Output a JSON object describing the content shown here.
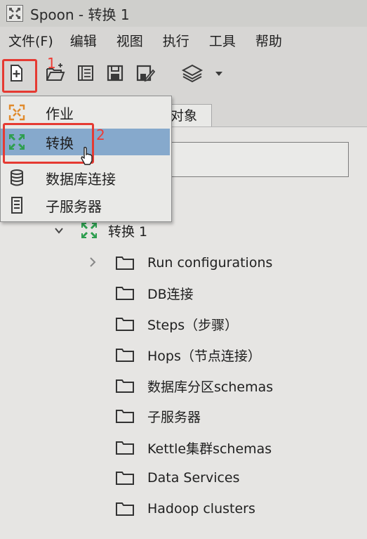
{
  "window": {
    "title": "Spoon - 转换 1"
  },
  "menu": {
    "file": "文件(F)",
    "edit": "编辑",
    "view": "视图",
    "run": "执行",
    "tools": "工具",
    "help": "帮助"
  },
  "toolbar": {
    "icons": [
      "new-file-icon",
      "open-folder-icon",
      "explore-icon",
      "save-icon",
      "save-as-icon",
      "layers-icon",
      "dropdown-arrow-icon"
    ],
    "annotation_1": "1"
  },
  "dropdown": {
    "items": [
      {
        "label": "作业",
        "icon": "job-icon"
      },
      {
        "label": "转换",
        "icon": "transformation-icon"
      },
      {
        "label": "数据库连接",
        "icon": "database-icon"
      },
      {
        "label": "子服务器",
        "icon": "slave-server-icon"
      }
    ],
    "selected_index": 1,
    "annotation_2": "2"
  },
  "tabs": {
    "partial_label": "对象"
  },
  "tree": {
    "root_label": "转换 1",
    "children": [
      "Run configurations",
      "DB连接",
      "Steps（步骤）",
      "Hops（节点连接）",
      "数据库分区schemas",
      "子服务器",
      "Kettle集群schemas",
      "Data Services",
      "Hadoop clusters"
    ]
  },
  "colors": {
    "highlight": "#86a9cc",
    "annotation_red": "#e53a32",
    "transform_green": "#2e9e4f",
    "job_orange": "#e08a2c"
  }
}
